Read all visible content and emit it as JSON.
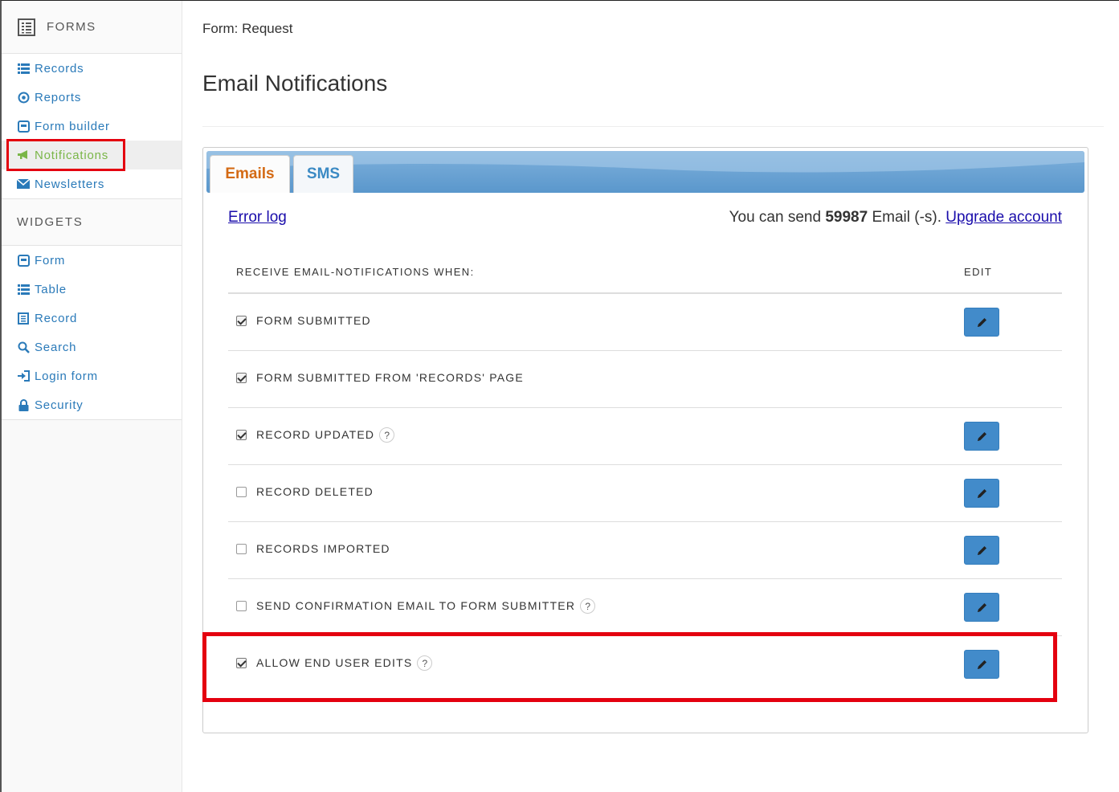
{
  "sidebar": {
    "forms_title": "FORMS",
    "forms_items": [
      {
        "label": "Records",
        "icon": "list-icon"
      },
      {
        "label": "Reports",
        "icon": "target-icon"
      },
      {
        "label": "Form builder",
        "icon": "form-icon"
      },
      {
        "label": "Notifications",
        "icon": "bullhorn-icon",
        "active": true
      },
      {
        "label": "Newsletters",
        "icon": "envelope-icon"
      }
    ],
    "widgets_title": "WIDGETS",
    "widgets_items": [
      {
        "label": "Form",
        "icon": "form-icon"
      },
      {
        "label": "Table",
        "icon": "list-icon"
      },
      {
        "label": "Record",
        "icon": "record-icon"
      },
      {
        "label": "Search",
        "icon": "search-icon"
      },
      {
        "label": "Login form",
        "icon": "login-icon"
      },
      {
        "label": "Security",
        "icon": "lock-icon"
      }
    ]
  },
  "main": {
    "breadcrumb": "Form: Request",
    "title": "Email Notifications",
    "tabs": [
      {
        "label": "Emails",
        "active": true
      },
      {
        "label": "SMS",
        "active": false
      }
    ],
    "error_log": "Error log",
    "quota_prefix": "You can send ",
    "quota_count": "59987",
    "quota_suffix": " Email (-s). ",
    "upgrade_link": "Upgrade account",
    "table": {
      "col_event": "RECEIVE EMAIL-NOTIFICATIONS WHEN:",
      "col_edit": "EDIT",
      "rows": [
        {
          "label": "FORM SUBMITTED",
          "checked": true,
          "help": false,
          "editable": true
        },
        {
          "label": "FORM SUBMITTED FROM 'RECORDS' PAGE",
          "checked": true,
          "help": false,
          "editable": false
        },
        {
          "label": "RECORD UPDATED",
          "checked": true,
          "help": true,
          "editable": true
        },
        {
          "label": "RECORD DELETED",
          "checked": false,
          "help": false,
          "editable": true
        },
        {
          "label": "RECORDS IMPORTED",
          "checked": false,
          "help": false,
          "editable": true
        },
        {
          "label": "SEND CONFIRMATION EMAIL TO FORM SUBMITTER",
          "checked": false,
          "help": true,
          "editable": true
        },
        {
          "label": "ALLOW END USER EDITS",
          "checked": true,
          "help": true,
          "editable": true
        }
      ],
      "help_glyph": "?"
    }
  },
  "colors": {
    "link": "#2a7ab9",
    "active_sidebar": "#7ab648",
    "button": "#428bca",
    "highlight": "#e4000f",
    "tab_emails": "#d46a14"
  }
}
